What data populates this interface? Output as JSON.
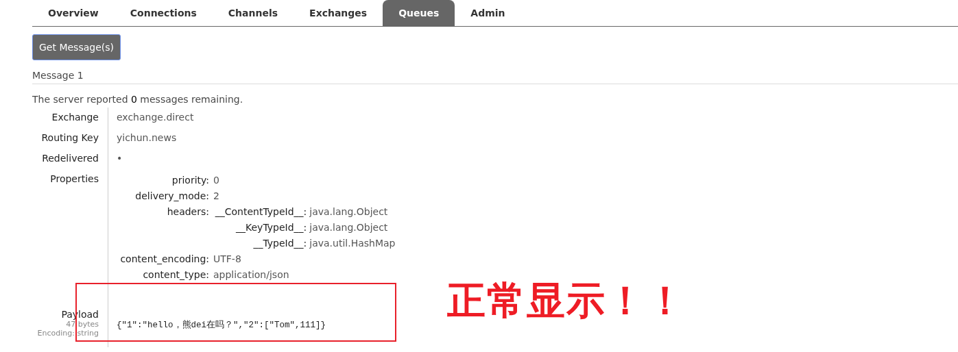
{
  "tabs": [
    {
      "label": "Overview",
      "selected": false
    },
    {
      "label": "Connections",
      "selected": false
    },
    {
      "label": "Channels",
      "selected": false
    },
    {
      "label": "Exchanges",
      "selected": false
    },
    {
      "label": "Queues",
      "selected": true
    },
    {
      "label": "Admin",
      "selected": false
    }
  ],
  "get_button": "Get Message(s)",
  "message_heading": "Message 1",
  "server_note": "The server reported **0** messages remaining.",
  "fields": [
    {
      "label": "Exchange",
      "value": "exchange.direct"
    },
    {
      "label": "Routing Key",
      "value": "yichun.news"
    },
    {
      "label": "Redelivered",
      "value": "•"
    }
  ],
  "properties": {
    "label": "Properties",
    "items": [
      {
        "kind": "text",
        "key": "priority:",
        "value": "0"
      },
      {
        "kind": "text",
        "key": "delivery_mode:",
        "value": "2"
      },
      {
        "kind": "table",
        "key": "headers:",
        "entries": [
          {
            "key": "__ContentTypeId__:",
            "value": "java.lang.Object"
          },
          {
            "key": "__KeyTypeId__:",
            "value": "java.lang.Object"
          },
          {
            "key": "__TypeId__:",
            "value": "java.util.HashMap"
          }
        ]
      },
      {
        "kind": "text",
        "key": "content_encoding:",
        "value": "UTF-8"
      },
      {
        "kind": "text",
        "key": "content_type:",
        "value": "application/json"
      }
    ]
  },
  "payload": {
    "label": "Payload",
    "size": "47 bytes",
    "encoding": "Encoding: string",
    "value": "{\"1\":\"hello，熊dei在吗？\",\"2\":[\"Tom\",111]}"
  },
  "annotation": {
    "text": "正常显示！！"
  }
}
